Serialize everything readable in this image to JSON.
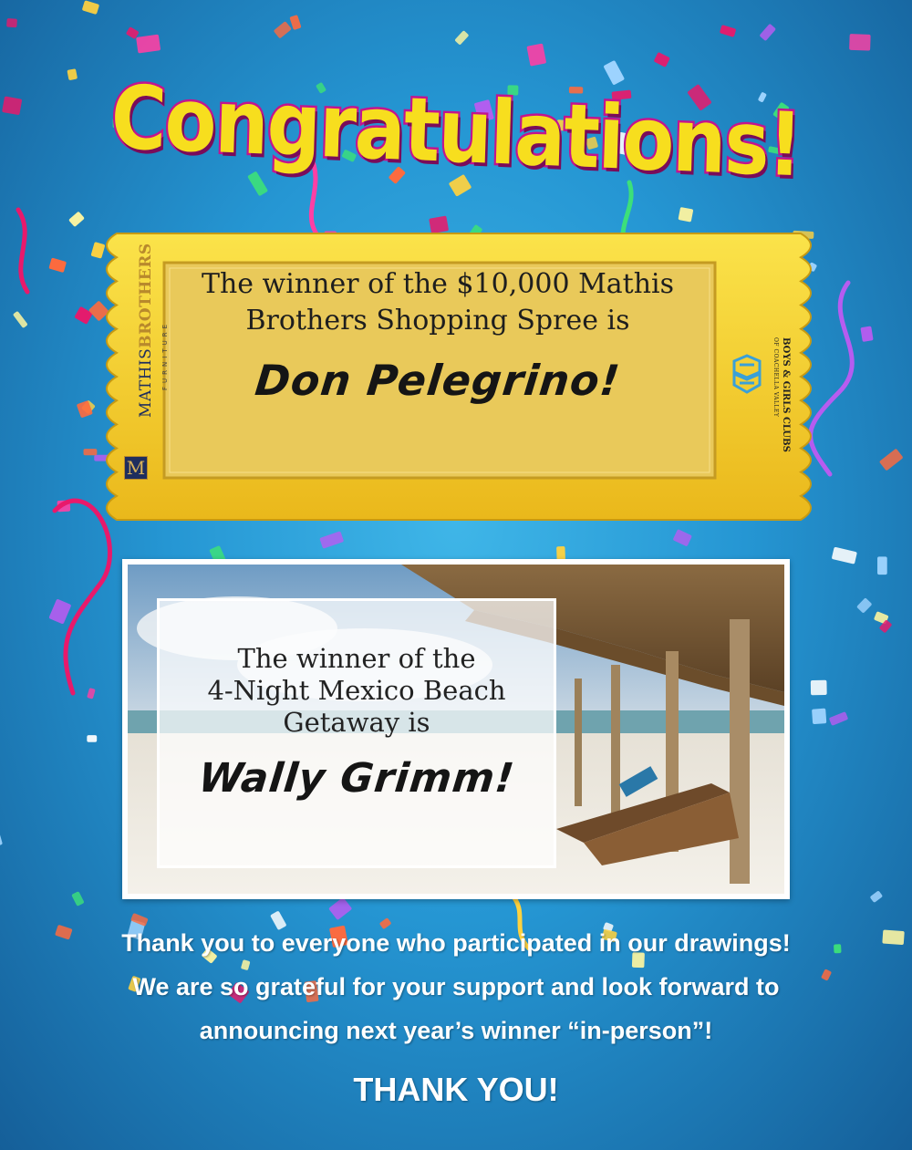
{
  "heading": "Congratulations!",
  "ticket": {
    "line1": "The winner of the $10,000 Mathis",
    "line2": "Brothers Shopping Spree is",
    "winner": "Don Pelegrino!",
    "left_logo": {
      "mark": "M",
      "name_a": "MATHIS",
      "name_b": "BROTHERS",
      "sub": "FURNITURE"
    },
    "right_logo": {
      "name": "BOYS & GIRLS CLUBS",
      "sub": "OF COACHELLA VALLEY"
    }
  },
  "beach": {
    "line1": "The winner of the",
    "line2": "4-Night Mexico Beach",
    "line3": "Getaway is",
    "winner": "Wally Grimm!"
  },
  "thanks": {
    "line1": "Thank you to everyone who participated in our drawings!",
    "line2": "We are so grateful for your support and look forward to",
    "line3": "announcing next year’s winner “in-person”!",
    "closing": "THANK YOU!"
  },
  "colors": {
    "background": "#2596d3",
    "heading_fill": "#f7de1e",
    "heading_outline": "#c3148f",
    "ticket_gold": "#f2cc2d",
    "ticket_inner": "#e9c95a"
  }
}
